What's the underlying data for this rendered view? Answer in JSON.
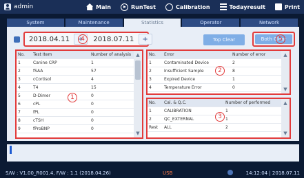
{
  "user": {
    "name": "admin"
  },
  "topnav": {
    "items": [
      {
        "label": "Main",
        "icon": "home-icon"
      },
      {
        "label": "RunTest",
        "icon": "play-icon"
      },
      {
        "label": "Calibration",
        "icon": "calibration-icon"
      },
      {
        "label": "Todayresult",
        "icon": "list-icon"
      },
      {
        "label": "Print",
        "icon": "print-icon"
      }
    ]
  },
  "tabs": [
    {
      "label": "System"
    },
    {
      "label": "Maintenance"
    },
    {
      "label": "Statistics"
    },
    {
      "label": "Operator"
    },
    {
      "label": "Network"
    }
  ],
  "dates": {
    "from": "2018.04.11",
    "to": "2018.07.11",
    "stepper_icon": "plus-icon"
  },
  "buttons": {
    "top_clear": "Top Clear",
    "both_clear": "Both Clear"
  },
  "tables": {
    "analysis": {
      "headers": [
        "No.",
        "Test Item",
        "Number of analysis"
      ],
      "rows": [
        [
          "1",
          "Canine CRP",
          "1"
        ],
        [
          "2",
          "fSAA",
          "57"
        ],
        [
          "3",
          "cCortisol",
          "4"
        ],
        [
          "4",
          "T4",
          "15"
        ],
        [
          "5",
          "D-Dimer",
          "0"
        ],
        [
          "6",
          "cPL",
          "0"
        ],
        [
          "7",
          "fPL",
          "0"
        ],
        [
          "8",
          "cTSH",
          "0"
        ],
        [
          "9",
          "fProBNP",
          "0"
        ]
      ]
    },
    "error": {
      "headers": [
        "No.",
        "Error",
        "Number of error"
      ],
      "rows": [
        [
          "1",
          "Contaminated Device",
          "2"
        ],
        [
          "2",
          "Insufficient Sample",
          "8"
        ],
        [
          "3",
          "Expired Device",
          "1"
        ],
        [
          "4",
          "Temperature Error",
          "0"
        ]
      ]
    },
    "calibration": {
      "headers": [
        "No.",
        "Cal. & Q.C.",
        "Number of performed"
      ],
      "rows": [
        [
          "1",
          "CALIBRATION",
          "1"
        ],
        [
          "2",
          "QC_EXTERNAL",
          "1"
        ],
        [
          "Rest",
          "ALL",
          "2"
        ]
      ]
    }
  },
  "callouts": [
    "1",
    "2",
    "3",
    "4",
    "5"
  ],
  "message": {
    "text": ""
  },
  "status": {
    "version": "S/W : V1.00_R001.4, F/W : 1.1 (2018.04.26)",
    "usb": "USB",
    "time": "14:12:04 | 2018.07.11"
  }
}
